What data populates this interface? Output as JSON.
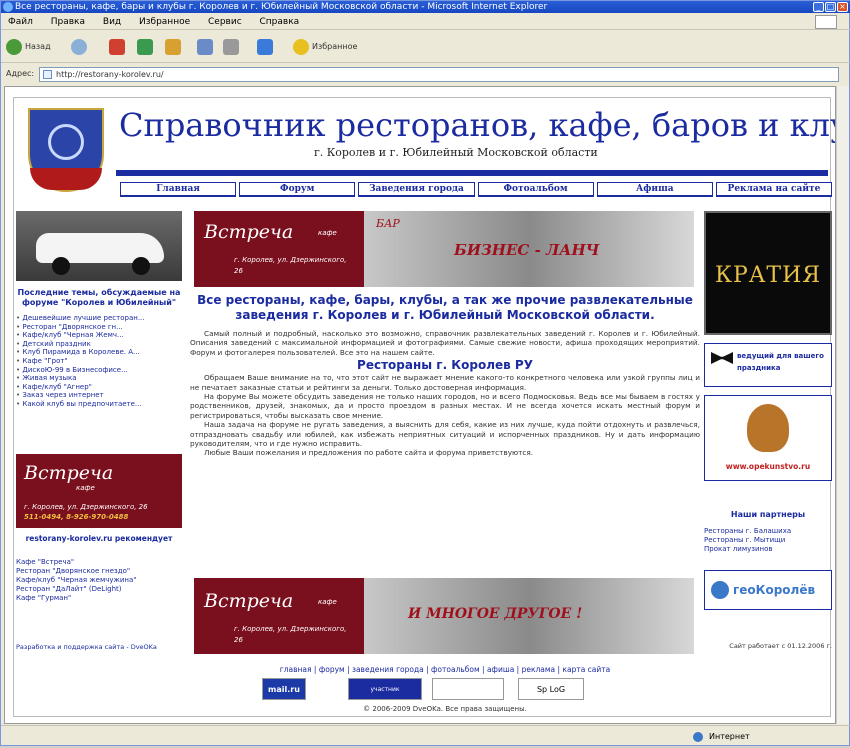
{
  "window": {
    "title": "Все рестораны, кафе, бары и клубы г. Королев и г. Юбилейный Московской области - Microsoft Internet Explorer"
  },
  "menu": [
    "Файл",
    "Правка",
    "Вид",
    "Избранное",
    "Сервис",
    "Справка"
  ],
  "toolbar": {
    "back": "Назад",
    "favorites": "Избранное"
  },
  "address": {
    "label": "Адрес:",
    "url": "http://restorany-korolev.ru/"
  },
  "status": {
    "zone": "Интернет"
  },
  "site": {
    "title": "Справочник ресторанов, кафе, баров и клубов",
    "subtitle": "г. Королев и г. Юбилейный Московской области",
    "nav": [
      "Главная",
      "Форум",
      "Заведения города",
      "Фотоальбом",
      "Афиша",
      "Реклама на сайте"
    ]
  },
  "left": {
    "forum_heading": "Последние темы, обсуждаемые на форуме \"Королев и Юбилейный\"",
    "forum_topics": [
      "Дешевейшие лучшие ресторан...",
      "Ресторан \"Дворянское гн...",
      "Кафе/клуб \"Черная Жемч...",
      "Детский праздник",
      "Клуб Пирамида в Королеве. А...",
      "Кафе \"Грот\"",
      "ДискоЮ-99 в Бизнесофисе...",
      "Живая музыка",
      "Кафе/клуб \"Агнер\"",
      "Заказ через интернет",
      "Какой клуб вы предпочитаете..."
    ],
    "recommend_heading": "restorany-korolev.ru рекомендует",
    "recommend": [
      "Кафе \"Встреча\"",
      "Ресторан \"Дворянское гнездо\"",
      "Кафе/клуб \"Черная жемчужина\"",
      "Ресторан \"ДаЛайт\" (DeLight)",
      "Кафе \"Гурман\""
    ],
    "dev": "Разработка и поддержка сайта - DveOKa"
  },
  "banner_top": {
    "brand": "Встреча",
    "kafe": "кафе",
    "address": "г. Королев, ул. Дзержинского, 26",
    "bar": "БАР",
    "tagline": "БИЗНЕС - ЛАНЧ"
  },
  "banner_left": {
    "brand": "Встреча",
    "kafe": "кафе",
    "address": "г. Королев, ул. Дзержинского, 26",
    "phone": "511-0494, 8-926-970-0488"
  },
  "banner_bottom": {
    "brand": "Встреча",
    "kafe": "кафе",
    "address": "г. Королев, ул. Дзержинского, 26",
    "tagline": "И МНОГОЕ ДРУГОЕ !"
  },
  "center": {
    "heading": "Все рестораны, кафе, бары, клубы, а так же прочие развлекательные заведения г. Королев и г. Юбилейный Московской области.",
    "p1": "Самый полный и подробный, насколько это возможно, справочник развлекательных заведений г. Королев и г. Юбилейный. Описания заведений с максимальной информацией и фотографиями. Самые свежие новости, афиша проходящих мероприятий. Форум и фотогалерея пользователей. Все это на нашем сайте.",
    "section": "Рестораны г. Королев РУ",
    "p2": "Обращаем Ваше внимание на то, что этот сайт не выражает мнение какого-то конкретного человека или узкой группы лиц и не печатает заказные статьи и рейтинги за деньги. Только достоверная информация.",
    "p3": "На форуме Вы можете обсудить заведения не только наших городов, но и всего Подмосковья. Ведь все мы бываем в гостях у родственников, друзей, знакомых, да и просто проездом в разных местах. И не всегда хочется искать местный форум и регистрироваться, чтобы высказать свое мнение.",
    "p4": "Наша задача на форуме не ругать заведения, а выяснить для себя, какие из них лучше, куда пойти отдохнуть и развлечься, отпраздновать свадьбу или юбилей, как избежать неприятных ситуаций и испорченных праздников. Ну и дать информацию руководителям, что и где нужно исправить.",
    "p5": "Любые Ваши пожелания и предложения по работе сайта и форума приветствуются."
  },
  "right": {
    "kratia": "КРАТИЯ",
    "ad1": "ведущий для вашего праздника",
    "ad2": "www.opekunstvo.ru",
    "partners_heading": "Наши партнеры",
    "partners": [
      "Рестораны г. Балашиха",
      "Рестораны г. Мытищи",
      "Прокат лимузинов"
    ],
    "geo": "геоКоролёв",
    "since": "Сайт работает с 01.12.2006 г."
  },
  "footer": {
    "links": "главная | форум | заведения города | фотоальбом | афиша | реклама | карта сайта",
    "c1": "mail.ru",
    "c2": "участник",
    "c4": "Sp LoG",
    "copyright": "© 2006-2009 DveOKa. Все права защищены."
  }
}
